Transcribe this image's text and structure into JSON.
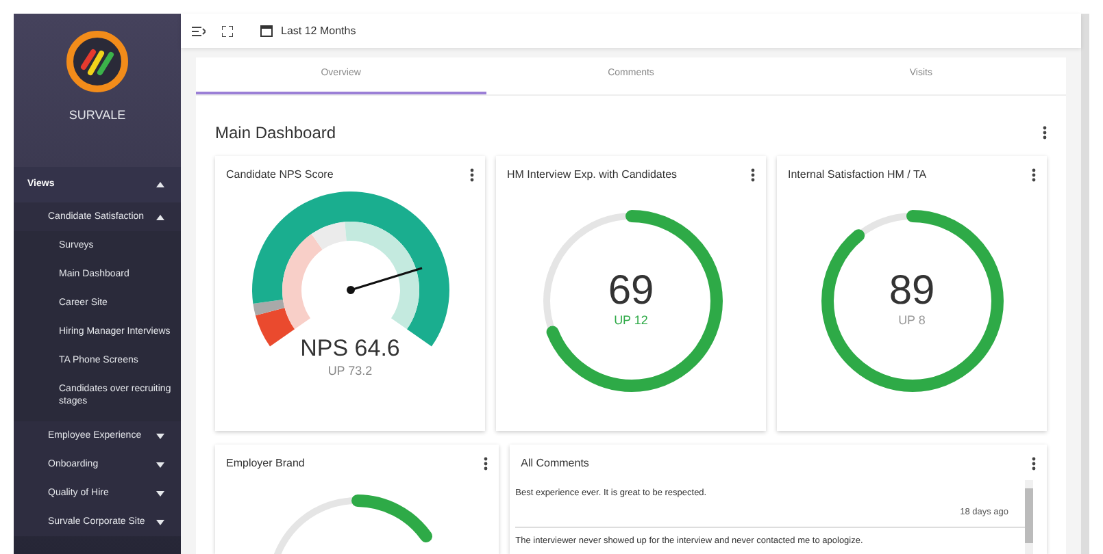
{
  "sidebar": {
    "brand": "SURVALE",
    "sections": [
      {
        "label": "Views",
        "expanded": true,
        "children": [
          {
            "label": "Candidate Satisfaction",
            "expanded": true,
            "children": [
              {
                "label": "Surveys"
              },
              {
                "label": "Main Dashboard"
              },
              {
                "label": "Career Site"
              },
              {
                "label": "Hiring Manager Interviews"
              },
              {
                "label": "TA Phone Screens"
              },
              {
                "label": "Candidates over recruiting stages"
              }
            ]
          },
          {
            "label": "Employee Experience",
            "expanded": false
          },
          {
            "label": "Onboarding",
            "expanded": false
          },
          {
            "label": "Quality of Hire",
            "expanded": false
          },
          {
            "label": "Survale Corporate Site",
            "expanded": false
          }
        ]
      }
    ]
  },
  "toolbar": {
    "date_range": "Last 12 Months"
  },
  "tabs": [
    {
      "label": "Overview",
      "selected": true
    },
    {
      "label": "Comments",
      "selected": false
    },
    {
      "label": "Visits",
      "selected": false
    }
  ],
  "dashboard": {
    "title": "Main Dashboard",
    "cards": [
      {
        "kind": "gauge",
        "title": "Candidate NPS Score",
        "value": "NPS 64.6",
        "delta": "UP 73.2"
      },
      {
        "kind": "ring",
        "title": "HM Interview Exp. with Candidates",
        "value": "69",
        "delta": "UP 12",
        "level": 0.69,
        "delta_positive": true
      },
      {
        "kind": "ring",
        "title": "Internal Satisfaction HM / TA",
        "value": "89",
        "delta": "UP 8",
        "level": 0.89,
        "delta_positive": false
      }
    ],
    "bottom": {
      "employer_brand": {
        "title": "Employer Brand"
      },
      "comments": {
        "title": "All Comments",
        "items": [
          {
            "text": "Best experience ever. It is great to be respected.",
            "time": "18 days ago"
          },
          {
            "text": "The interviewer never showed up for the interview and never contacted me to apologize."
          }
        ]
      }
    }
  }
}
